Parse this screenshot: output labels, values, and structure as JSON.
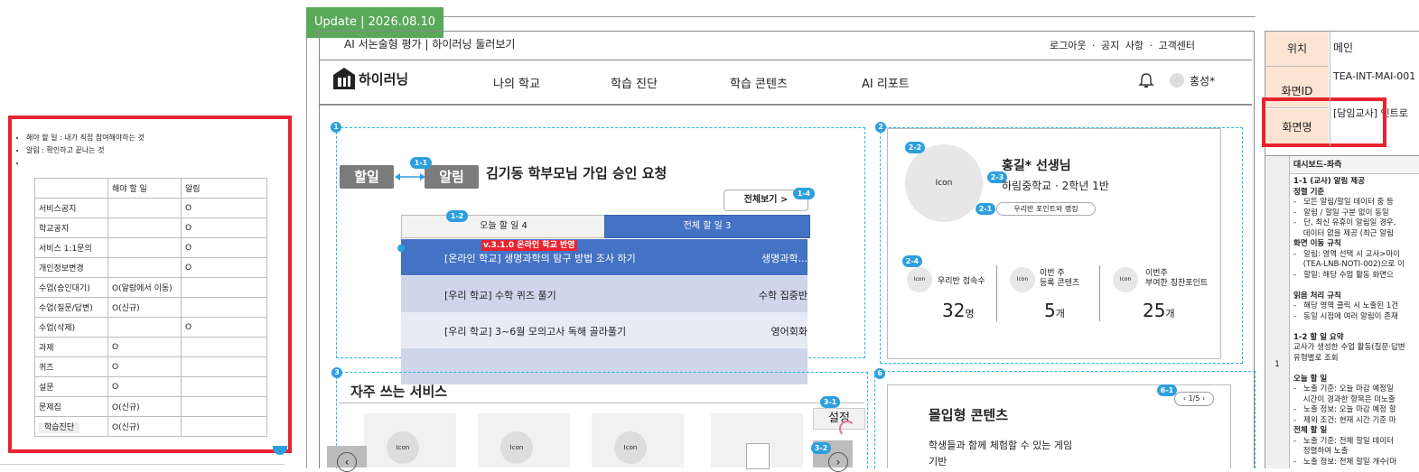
{
  "update_tag": "Update | 2026.08.10",
  "legend": {
    "bullets": [
      "해야 할 일 : 내가 직접 참여해야하는 것",
      "알림 : 확인하고 끝나는 것",
      ""
    ],
    "columns": [
      "",
      "해야 할 일",
      "알림"
    ],
    "rows": [
      [
        "서비스공지",
        "",
        "O"
      ],
      [
        "학교공지",
        "",
        "O"
      ],
      [
        "서비스 1:1문의",
        "",
        "O"
      ],
      [
        "개인정보변경",
        "",
        "O"
      ],
      [
        "수업(승인대기)",
        "O(알람에서 이동)",
        ""
      ],
      [
        "수업(질문/답변)",
        "O(신규)",
        ""
      ],
      [
        "수업(삭제)",
        "",
        "O"
      ],
      [
        "과제",
        "O",
        ""
      ],
      [
        "퀴즈",
        "O",
        ""
      ],
      [
        "설문",
        "O",
        ""
      ],
      [
        "문제집",
        "O(신규)",
        ""
      ],
      [
        "학습진단",
        "O(신규)",
        ""
      ]
    ]
  },
  "topbar": {
    "title": "AI 서논술형 평가 | 하이러닝 둘러보기",
    "links": [
      "로그아웃",
      "·",
      "공지 사항",
      "·",
      "고객센터"
    ]
  },
  "nav": {
    "logo": "하이러닝",
    "items": [
      "나의 학교",
      "학습 진단",
      "학습 콘텐츠",
      "AI 리포트"
    ],
    "user": "홍성*"
  },
  "badges": {
    "b1": "1",
    "b1_1": "1-1",
    "b1_2": "1-2",
    "b1_4": "1-4",
    "b2": "2",
    "b2_1": "2-1",
    "b2_2": "2-2",
    "b2_3": "2-3",
    "b2_4": "2-4",
    "b3": "3",
    "b3_1": "3-1",
    "b3_2": "3-2",
    "b6": "6",
    "b6_1": "6-1"
  },
  "notice": {
    "todo_label": "할일",
    "alert_label": "알림",
    "headline": "김기동 학부모님 가입 승인 요청",
    "view_all": "전체보기 >",
    "tab_today": "오늘 할 일  4",
    "tab_all": "전체 할 일 3",
    "version_tag": "v.3.1.0 온라인 학교 반영",
    "tasks": [
      {
        "title": "[온라인 학교] 생명과학의 탐구 방법 조사 하기",
        "subject": "생명과학..."
      },
      {
        "title": "[우리 학교] 수학 퀴즈 풀기",
        "subject": "수학 집중반"
      },
      {
        "title": "[우리 학교] 3~6월 모의고사 독해 골라풀기",
        "subject": "영어회화"
      }
    ]
  },
  "profile": {
    "icon": "Icon",
    "name": "홍길* 선생님",
    "school": "하림중학교 · 2학년 1반",
    "class_button": "우리반 포인트와 랭킹",
    "stats": [
      {
        "icon": "Icon",
        "label": "우리반 접속수",
        "value": "32",
        "unit": "명"
      },
      {
        "icon": "Icon",
        "label": "이번 주\n등록 콘텐츠",
        "value": "5",
        "unit": "개"
      },
      {
        "icon": "Icon",
        "label": "이번주\n부여한 칭찬포인트",
        "value": "25",
        "unit": "개"
      }
    ]
  },
  "services": {
    "title": "자주 쓰는 서비스",
    "settings": "설정",
    "icon": "Icon"
  },
  "immersive": {
    "pager": "1/5",
    "title": "몰입형 콘텐츠",
    "desc": "학생들과 함께 체험할 수 있는 게임",
    "desc2": "기반"
  },
  "spec": {
    "location_label": "위치",
    "location_value": "메인",
    "screen_id_label": "화면ID",
    "screen_id_value": "TEA-INT-MAI-001",
    "screen_name_label": "화면명",
    "screen_name_value": "[담임교사] 인트로",
    "section_title": "대시보드-좌측",
    "row_num": "1",
    "lines": [
      "1-1 (교사) 알림 제공",
      "정렬 기준",
      "-   모든 알림/할일 데이터 중 등",
      "-   알림 / 할일 구분 없이 동일",
      "-   단, 최신 유휴이 알림일 경우,",
      "    데이터 없을 제공 (최근 알림",
      "화면 이동 규칙",
      "-   알림: 영역 선택 시 교사>마이",
      "    (TEA-LNB-NOTI-002)으로 이",
      "-   할일: 해당 수업 활동 화면으",
      "",
      "읽음 처리 규칙",
      "-   해당 영역 클릭 시 노출된 1건",
      "-   동일 시점에 여러 알림이 존재",
      "",
      "1-2 할 일 요약",
      "교사가 생성한 수업 활동(질문·답변",
      "유형별로 조회",
      "",
      "오늘 할 일",
      "-   노출 기준: 오늘 마감 예정일",
      "    시간이 경과한 항목은 미노출",
      "-   노출 정보: 오늘 마감 예정 할",
      "-   제외 조건: 현재 시간 기준 마",
      "전체 할 일",
      "-   노출 기준: 전체 할일 데이터",
      "    정렬하여 노출",
      "-   노출 정보: 전체 할일 개수(마"
    ]
  }
}
